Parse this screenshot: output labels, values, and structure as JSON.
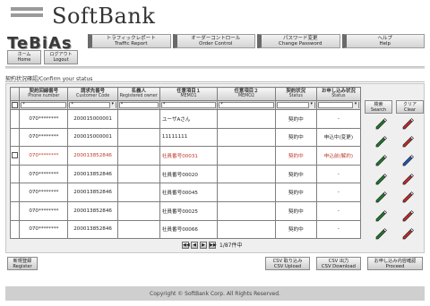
{
  "brand": {
    "logo_text": "SoftBank",
    "app_name": "TeBiAs"
  },
  "topnav": [
    {
      "ja": "トラフィックレポート",
      "en": "Traffic Report"
    },
    {
      "ja": "オーダーコントロール",
      "en": "Order Control"
    },
    {
      "ja": "パスワード変更",
      "en": "Change Password"
    },
    {
      "ja": "ヘルプ",
      "en": "Help"
    }
  ],
  "subnav": [
    {
      "ja": "ホーム",
      "en": "Home"
    },
    {
      "ja": "ログアウト",
      "en": "Logout"
    }
  ],
  "section_title": "契約状況確認/Confirm your status",
  "table": {
    "columns": [
      {
        "ja": "契約回線番号",
        "en": "Phone number"
      },
      {
        "ja": "請求先番号",
        "en": "Customer Code"
      },
      {
        "ja": "名義人",
        "en": "Registered owner"
      },
      {
        "ja": "任意項目１",
        "en": "MEMO1"
      },
      {
        "ja": "任意項目２",
        "en": "MEMO2"
      },
      {
        "ja": "契約状況",
        "en": "Status"
      },
      {
        "ja": "お申し込み状況",
        "en": "Status"
      }
    ],
    "filter": [
      "*",
      "*",
      "*",
      "*",
      "*",
      "",
      ""
    ],
    "rows": [
      {
        "phone": "070********",
        "code": "200015000001",
        "owner": "",
        "memo1": "ユーザAさん",
        "memo2": "",
        "status": "契約中",
        "apply": "-"
      },
      {
        "phone": "070********",
        "code": "200015000001",
        "owner": "",
        "memo1": "11111111",
        "memo2": "",
        "status": "契約中",
        "apply": "申込中(変更)"
      },
      {
        "phone": "070********",
        "code": "200013852846",
        "owner": "",
        "memo1": "社員番号00031",
        "memo2": "",
        "status": "契約中",
        "apply": "申込前(解約)"
      },
      {
        "phone": "070********",
        "code": "200013852846",
        "owner": "",
        "memo1": "社員番号00020",
        "memo2": "",
        "status": "契約中",
        "apply": "-"
      },
      {
        "phone": "070********",
        "code": "200013852846",
        "owner": "",
        "memo1": "社員番号00045",
        "memo2": "",
        "status": "契約中",
        "apply": "-"
      },
      {
        "phone": "070********",
        "code": "200013852846",
        "owner": "",
        "memo1": "社員番号00025",
        "memo2": "",
        "status": "契約中",
        "apply": "-"
      },
      {
        "phone": "070********",
        "code": "200013852846",
        "owner": "",
        "memo1": "社員番号00066",
        "memo2": "",
        "status": "契約中",
        "apply": "-"
      }
    ]
  },
  "side": {
    "search": {
      "ja": "検索",
      "en": "Search"
    },
    "clear": {
      "ja": "クリア",
      "en": "Clear"
    }
  },
  "pager": {
    "count": "1/87件中"
  },
  "actions": {
    "register": {
      "ja": "新規登録",
      "en": "Register"
    },
    "csv_upload": {
      "ja": "CSV 取り込み",
      "en": "CSV Upload"
    },
    "csv_download": {
      "ja": "CSV 出力",
      "en": "CSV Download"
    },
    "proceed": {
      "ja": "お申し込み内容確認",
      "en": "Proceed"
    }
  },
  "footer": {
    "copyright": "Copyright © SoftBank Corp. All Rights Reserved."
  },
  "colors": {
    "pen_green": "#1f7a2c",
    "pen_red": "#c62828",
    "pen_blue": "#1e56c6",
    "red_text": "#c0392b"
  },
  "icons": {
    "edit": "green-pen-icon",
    "delete": "red-pen-icon",
    "restore": "blue-pen-icon"
  }
}
